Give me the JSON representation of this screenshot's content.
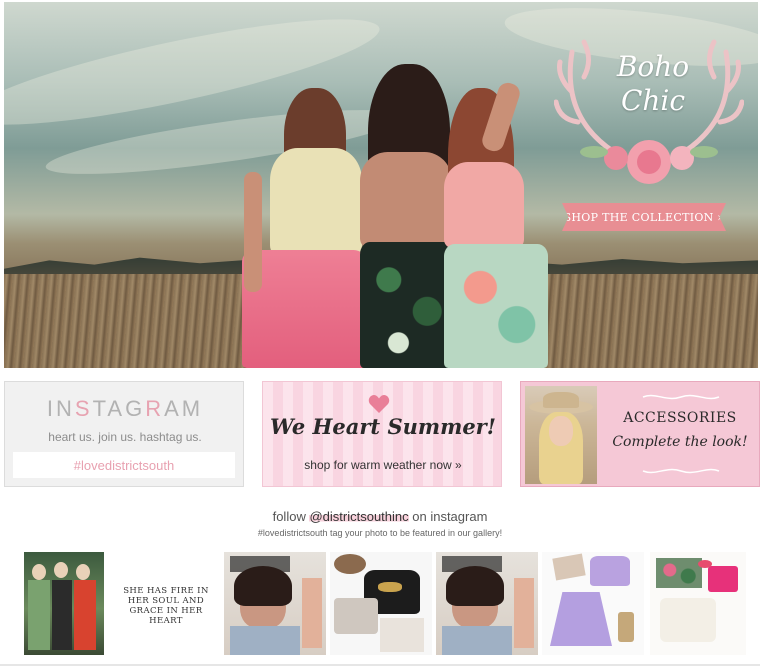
{
  "hero": {
    "brand_line1": "Boho",
    "brand_line2": "Chic",
    "cta_label": "SHOP THE COLLECTION »"
  },
  "banners": {
    "instagram": {
      "title_parts": [
        "IN",
        "S",
        "TAG",
        "R",
        "AM"
      ],
      "subtitle": "heart us. join us. hashtag us.",
      "hashtag": "#lovedistrictsouth"
    },
    "summer": {
      "title": "We Heart Summer!",
      "subtitle": "shop for warm weather now  »"
    },
    "accessories": {
      "title": "ACCESSORIES",
      "subtitle": "Complete the look!"
    }
  },
  "follow": {
    "prefix": "follow ",
    "handle": "@districtsouthinc",
    "suffix": " on instagram",
    "tagline": "#lovedistrictsouth tag your photo to be featured in our gallery!"
  },
  "gallery": {
    "quote": "SHE HAS FIRE IN HER SOUL AND GRACE IN HER HEART",
    "tiles": [
      "photo-group",
      "quote",
      "magazine-cover",
      "black-top-outfit",
      "magazine-cover",
      "lavender-outfit",
      "floral-outfit"
    ]
  },
  "colors": {
    "accent_pink": "#e88e93",
    "banner_pink": "#f5c8d6"
  }
}
